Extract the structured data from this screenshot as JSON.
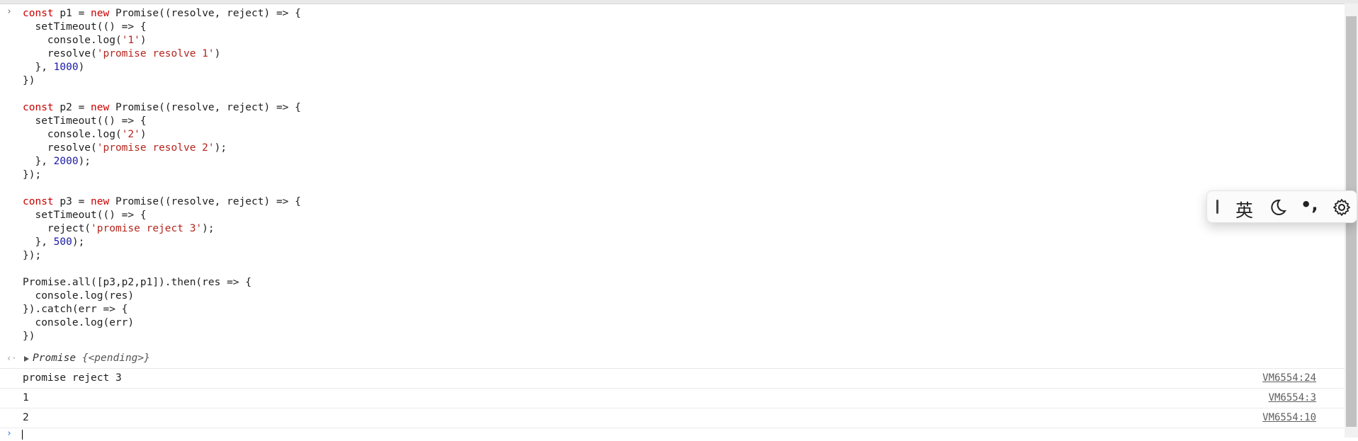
{
  "console": {
    "input_prompt": "›",
    "result_prompt": "‹·",
    "code": {
      "p1": {
        "l1_a": "const",
        "l1_b": " p1 = ",
        "l1_c": "new",
        "l1_d": " Promise((resolve, reject) => {",
        "l2": "  setTimeout(() => {",
        "l3_a": "    console.log(",
        "l3_b": "'1'",
        "l3_c": ")",
        "l4_a": "    resolve(",
        "l4_b": "'promise resolve 1'",
        "l4_c": ")",
        "l5_a": "  }, ",
        "l5_b": "1000",
        "l5_c": ")",
        "l6": "})"
      },
      "p2": {
        "l1_a": "const",
        "l1_b": " p2 = ",
        "l1_c": "new",
        "l1_d": " Promise((resolve, reject) => {",
        "l2": "  setTimeout(() => {",
        "l3_a": "    console.log(",
        "l3_b": "'2'",
        "l3_c": ")",
        "l4_a": "    resolve(",
        "l4_b": "'promise resolve 2'",
        "l4_c": ");",
        "l5_a": "  }, ",
        "l5_b": "2000",
        "l5_c": ");",
        "l6": "});"
      },
      "p3": {
        "l1_a": "const",
        "l1_b": " p3 = ",
        "l1_c": "new",
        "l1_d": " Promise((resolve, reject) => {",
        "l2": "  setTimeout(() => {",
        "l3_a": "    reject(",
        "l3_b": "'promise reject 3'",
        "l3_c": ");",
        "l4_a": "  }, ",
        "l4_b": "500",
        "l4_c": ");",
        "l5": "});"
      },
      "all": {
        "l1": "Promise.all([p3,p2,p1]).then(res => {",
        "l2": "  console.log(res)",
        "l3": "}).catch(err => {",
        "l4": "  console.log(err)",
        "l5": "})"
      }
    },
    "result": {
      "label": "Promise",
      "state": "{<pending>}"
    },
    "logs": [
      {
        "message": "promise reject 3",
        "source": "VM6554:24"
      },
      {
        "message": "1",
        "source": "VM6554:3"
      },
      {
        "message": "2",
        "source": "VM6554:10"
      }
    ]
  },
  "ime_toolbar": {
    "language": "英",
    "punctuation": "•,",
    "icons": [
      "grip-icon",
      "moon-icon",
      "gear-icon"
    ]
  }
}
